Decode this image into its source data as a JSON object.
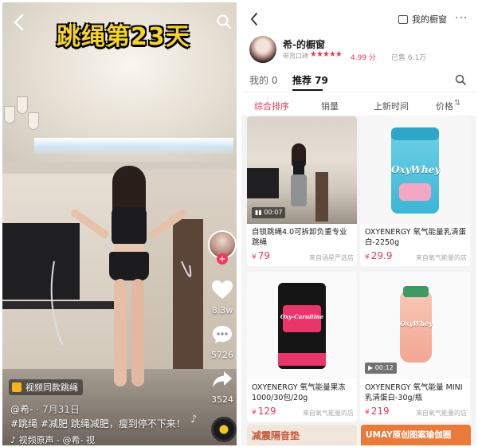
{
  "video": {
    "title_overlay": "跳绳第23天",
    "tag_chip": "视频同款跳绳",
    "author": "@希-",
    "date": "· 7月31日",
    "caption": "#跳绳 #减肥 跳绳减肥，瘦到停不下来！",
    "music": "视频原声 - @希-   视",
    "likes": "8.3w",
    "comments": "5726",
    "shares": "3524",
    "follow_plus": "+"
  },
  "shop": {
    "header_link": "我的橱窗",
    "more": "···",
    "profile_name": "希-的橱窗",
    "reputation_label": "带货口碑",
    "stars": "★★★★★",
    "score": "4.99 分",
    "sold": "已售 6.1万",
    "tabs": [
      {
        "label": "我的 0"
      },
      {
        "label": "推荐 79"
      }
    ],
    "sort": [
      {
        "label": "综合排序"
      },
      {
        "label": "销量"
      },
      {
        "label": "上新时间"
      },
      {
        "label": "价格"
      }
    ],
    "products": [
      {
        "title": "自锁跳绳4.0可拆卸负重专业跳绳",
        "currency": "¥",
        "price": "79",
        "source": "来自涵星严选店",
        "duration": "▮▮ 00:07"
      },
      {
        "title": "OXYENERGY 氧气能量乳清蛋白-2250g",
        "currency": "¥",
        "price": "29.9",
        "source": "来自氧气能量的店",
        "brand": "OxyWhey"
      },
      {
        "title": "OXYENERGY 氧气能量果冻1000/30包/20g",
        "currency": "¥",
        "price": "129",
        "source": "来自氧气能量的店",
        "brand": "Oxy-Carnitine"
      },
      {
        "title": "OXYENERGY 氧气能量 MINI 乳清蛋白-30g/瓶",
        "currency": "¥",
        "price": "219",
        "source": "来自氧气能量的店",
        "brand": "OxyWhey",
        "duration": "▶ 00:12"
      }
    ],
    "bottom_left": "减震隔音垫",
    "bottom_right": "UMAY原创图案瑜伽圈"
  },
  "colors": {
    "accent": "#e83a55",
    "title_yellow": "#f5d32a"
  }
}
